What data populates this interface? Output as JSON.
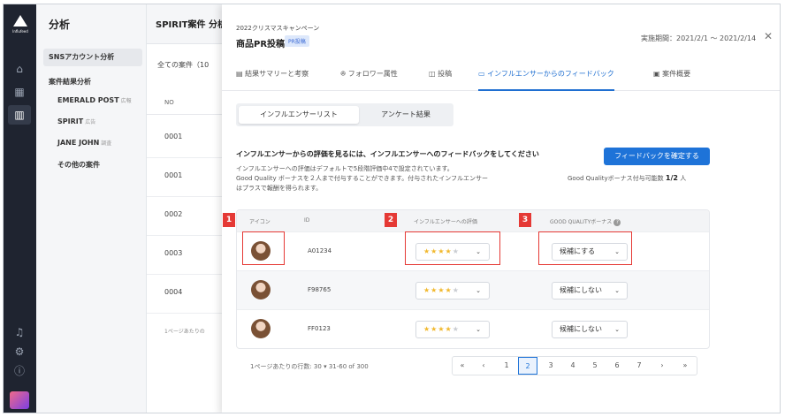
{
  "rail": {
    "logo_text": "Influfeed"
  },
  "sidebar": {
    "title": "分析",
    "items": [
      {
        "label": "SNSアカウント分析",
        "tag": ""
      },
      {
        "label": "案件結果分析",
        "tag": ""
      },
      {
        "label": "EMERALD POST",
        "tag": "広報"
      },
      {
        "label": "SPIRIT",
        "tag": "広告"
      },
      {
        "label": "JANE JOHN",
        "tag": "調査"
      },
      {
        "label": "その他の案件",
        "tag": ""
      }
    ]
  },
  "list": {
    "title": "SPIRIT案件 分析",
    "filter": "全ての案件（10",
    "col_no": "NO",
    "rows": [
      "0001",
      "0001",
      "0002",
      "0003",
      "0004"
    ],
    "footer": "1ページあたりの"
  },
  "panel": {
    "campaign": "2022クリスマスキャンペーン",
    "title": "商品PR投稿",
    "badge": "PR投稿",
    "period": "実施期間：2021/2/1 ～ 2021/2/14",
    "close": "✕",
    "tabs": [
      {
        "icon": "▤",
        "label": "結果サマリーと考察"
      },
      {
        "icon": "ꔮ",
        "label": "フォロワー属性"
      },
      {
        "icon": "◫",
        "label": "投稿"
      },
      {
        "icon": "▭",
        "label": "インフルエンサーからのフィードバック"
      },
      {
        "icon": "▣",
        "label": "案件概要"
      }
    ],
    "segment": [
      "インフルエンサーリスト",
      "アンケート結果"
    ],
    "feedback": {
      "heading": "インフルエンサーからの評価を見るには、インフルエンサーへのフィードバックをしてください",
      "desc1": "インフルエンサーへの評価はデフォルトで5段階評価中4で設定されています。",
      "desc2": "Good Quality ボーナスを２人まで付与することができます。付与されたインフルエンサー",
      "desc3": "はプラスで報酬を得られます。",
      "confirm_btn": "フィードバックを確定する",
      "bonus_label": "Good Qualityボーナス付与可能数",
      "bonus_value": "1/2",
      "bonus_unit": "人"
    },
    "table": {
      "headers": {
        "icon": "アイコン",
        "id": "ID",
        "rating": "インフルエンサーへの評価",
        "bonus": "GOOD QUALITYボーナス"
      },
      "rows": [
        {
          "id": "A01234",
          "rating": 4,
          "bonus": "候補にする"
        },
        {
          "id": "F98765",
          "rating": 4,
          "bonus": "候補にしない"
        },
        {
          "id": "FF0123",
          "rating": 4,
          "bonus": "候補にしない"
        }
      ]
    },
    "pagination": {
      "rows_per_page": "1ページあたりの行数:",
      "rpp_value": "30",
      "range": "31-60 of 300",
      "pages": [
        "1",
        "2",
        "3",
        "4",
        "5",
        "6",
        "7"
      ],
      "current": "2"
    },
    "markers": [
      "1",
      "2",
      "3"
    ]
  },
  "colors": {
    "accent": "#1e73d8",
    "marker": "#e53935",
    "star": "#f1b82d"
  }
}
